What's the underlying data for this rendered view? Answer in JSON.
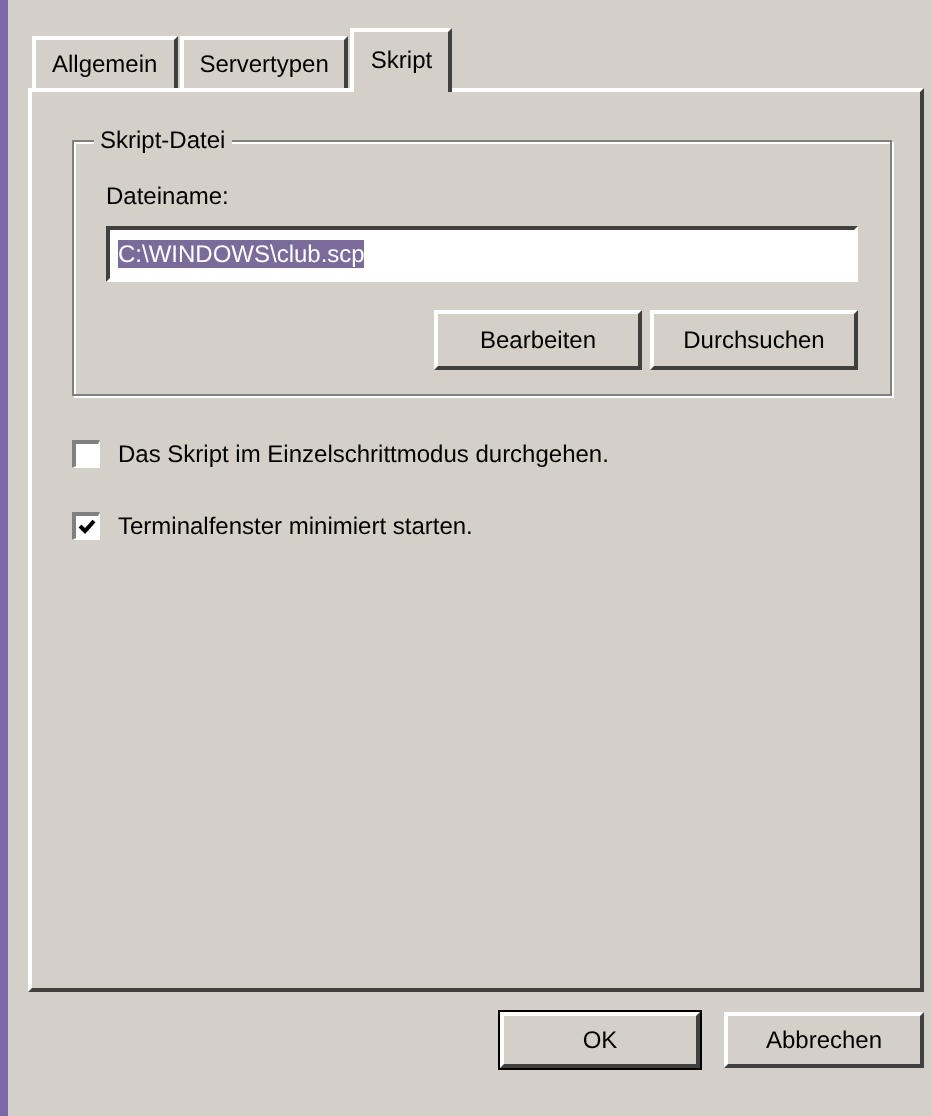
{
  "tabs": [
    {
      "label": "Allgemein",
      "selected": false
    },
    {
      "label": "Servertypen",
      "selected": false
    },
    {
      "label": "Skript",
      "selected": true
    }
  ],
  "group": {
    "title": "Skript-Datei",
    "field_label": "Dateiname:",
    "value": "C:\\WINDOWS\\club.scp",
    "value_selected": true,
    "buttons": [
      "Bearbeiten",
      "Durchsuchen"
    ]
  },
  "options": [
    {
      "label": "Das Skript im Einzelschrittmodus durchgehen.",
      "checked": false
    },
    {
      "label": "Terminalfenster minimiert starten.",
      "checked": true
    }
  ],
  "buttons": [
    {
      "label": "OK",
      "default": true
    },
    {
      "label": "Abbrechen",
      "default": false
    }
  ]
}
